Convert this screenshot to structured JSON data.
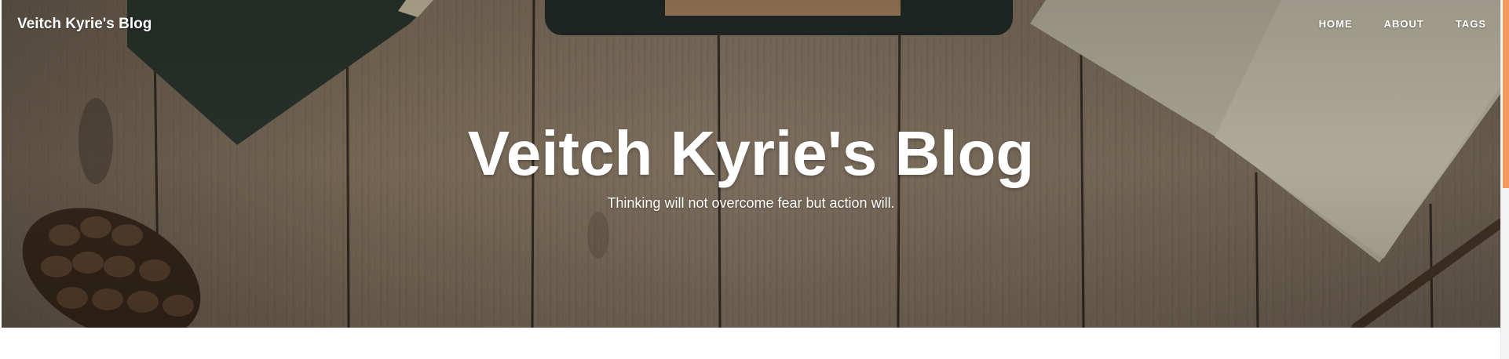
{
  "navbar": {
    "brand": "Veitch Kyrie's Blog",
    "links": [
      {
        "label": "HOME"
      },
      {
        "label": "ABOUT"
      },
      {
        "label": "TAGS"
      }
    ]
  },
  "hero": {
    "title": "Veitch Kyrie's Blog",
    "subtitle": "Thinking will not overcome fear but action will."
  },
  "colors": {
    "wood": "#8d7b65",
    "accent_scrollbar": "#f29a5c",
    "text": "#ffffff"
  }
}
